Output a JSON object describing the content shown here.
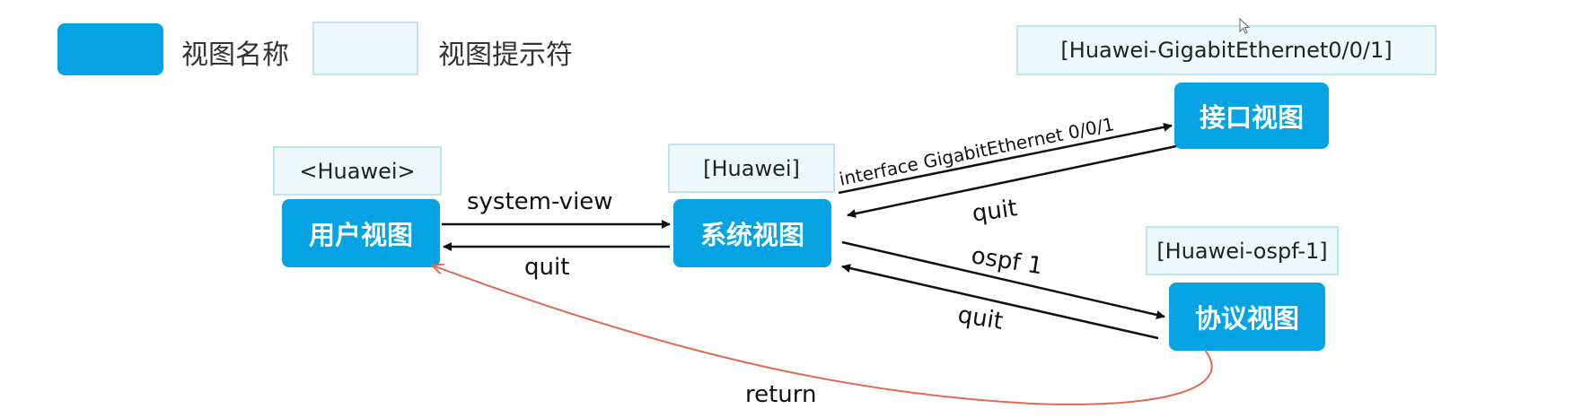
{
  "legend": {
    "view_name": "视图名称",
    "view_prompt": "视图提示符",
    "view_color": "#05a2e4",
    "prompt_color": "#eef8fb"
  },
  "nodes": {
    "user_view": {
      "name": "用户视图",
      "prompt": "<Huawei>"
    },
    "system_view": {
      "name": "系统视图",
      "prompt": "[Huawei]"
    },
    "interface_view": {
      "name": "接口视图",
      "prompt": "[Huawei-GigabitEthernet0/0/1]"
    },
    "protocol_view": {
      "name": "协议视图",
      "prompt": "[Huawei-ospf-1]"
    }
  },
  "edges": {
    "user_to_system": "system-view",
    "system_to_user": "quit",
    "system_to_interface": "interface GigabitEthernet 0/0/1",
    "interface_to_system": "quit",
    "system_to_protocol": "ospf 1",
    "protocol_to_system": "quit",
    "protocol_to_user": "return"
  },
  "colors": {
    "arrow": "#111111",
    "return_arrow": "#e06a50"
  }
}
